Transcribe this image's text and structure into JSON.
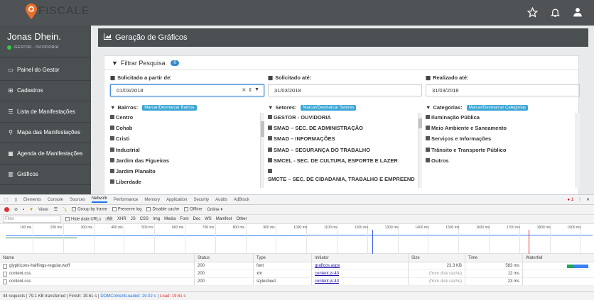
{
  "topbar": {
    "brand": "FISCALE",
    "icons": [
      "star-icon",
      "bell-icon",
      "user-icon"
    ]
  },
  "sidebar": {
    "user_name": "Jonas Dhein.",
    "user_role": "GESTOR - OUVIDORIA",
    "items": [
      {
        "label": "Painel do Gestor",
        "icon": "monitor-icon"
      },
      {
        "label": "Cadastros",
        "icon": "plus-square-icon"
      },
      {
        "label": "Lista de Manifestações",
        "icon": "list-icon"
      },
      {
        "label": "Mapa das Manifestações",
        "icon": "map-marker-user-icon"
      },
      {
        "label": "Agenda de Manifestações",
        "icon": "calendar-icon"
      },
      {
        "label": "Gráficos",
        "icon": "chart-icon"
      }
    ]
  },
  "page": {
    "title": "Geração de Gráficos",
    "filter_title": "Filtrar Pesquisa",
    "filter_badge": "0"
  },
  "dates": {
    "from_label": "Solicitado a partir de:",
    "from_value": "01/03/2018",
    "to_label": "Solicitado até:",
    "to_value": "31/03/2018",
    "done_label": "Realizado até:",
    "done_value": "31/03/2018"
  },
  "lists": {
    "bairros": {
      "label": "Bairros:",
      "tag": "Marcar/Desmarcar Bairros",
      "items": [
        "Centro",
        "Cohab",
        "Cristi",
        "Industrial",
        "Jardim das Figueiras",
        "Jardim Planalto",
        "Liberdade"
      ]
    },
    "setores": {
      "label": "Setores:",
      "tag": "Marcar/Desmarcar Setores",
      "items": [
        "GESTOR - OUVIDORIA",
        "SMAD – SEC. DE ADMINISTRAÇÃO",
        "SMAD – INFORMAÇÕES",
        "SMAD – SEGURANÇA DO TRABALHO",
        "SMCEL - SEC. DE CULTURA, ESPORTE E LAZER",
        "",
        "SMCTE – SEC. DE CIDADANIA, TRABALHO E EMPREEND"
      ]
    },
    "categorias": {
      "label": "Categorias:",
      "tag": "Marcar/Desmarcar Categorias",
      "items": [
        "Iluminação Pública",
        "Meio Ambiente e Saneamento",
        "Serviços e Informações",
        "Trânsito e Transporte Público",
        "Outros"
      ]
    }
  },
  "devtools": {
    "tabs": [
      "Elements",
      "Console",
      "Sources",
      "Network",
      "Performance",
      "Memory",
      "Application",
      "Security",
      "Audits",
      "AdBlock"
    ],
    "active_tab": "Network",
    "error_count": "1",
    "toolbar": {
      "view": "View:",
      "group_by_frame": "Group by frame",
      "preserve_log": "Preserve log",
      "disable_cache": "Disable cache",
      "offline": "Offline",
      "online": "Online"
    },
    "filter": {
      "placeholder": "Filter",
      "hide_data_urls": "Hide data URLs",
      "types": [
        "All",
        "XHR",
        "JS",
        "CSS",
        "Img",
        "Media",
        "Font",
        "Doc",
        "WS",
        "Manifest",
        "Other"
      ]
    },
    "timeline_ticks": [
      "100 ms",
      "200 ms",
      "300 ms",
      "400 ms",
      "500 ms",
      "600 ms",
      "700 ms",
      "800 ms",
      "900 ms",
      "1000 ms",
      "1100 ms",
      "1200 ms",
      "1300 ms",
      "1400 ms",
      "1500 ms",
      "1600 ms",
      "1700 ms",
      "1800 ms",
      "1900 ms"
    ],
    "columns": [
      "Name",
      "Status",
      "Type",
      "Initiator",
      "Size",
      "Time",
      "Waterfall"
    ],
    "rows": [
      {
        "name": "glyphicons-halflings-regular.woff",
        "status": "200",
        "type": "font",
        "initiator": "graficos.aspx",
        "size": "23.3 KB",
        "time": "583 ms"
      },
      {
        "name": "content.css",
        "status": "200",
        "type": "xhr",
        "initiator": "content.js:43",
        "size": "(from disk cache)",
        "time": "12 ms"
      },
      {
        "name": "content.css",
        "status": "200",
        "type": "stylesheet",
        "initiator": "content.js:43",
        "size": "(from disk cache)",
        "time": "23 ms"
      }
    ],
    "status_bar": {
      "summary": "44 requests | 79.1 KB transferred | Finish: 19.61 s |",
      "dcl": "DOMContentLoaded: 19.02 s",
      "sep": "|",
      "load": "Load: 19.61 s"
    }
  }
}
